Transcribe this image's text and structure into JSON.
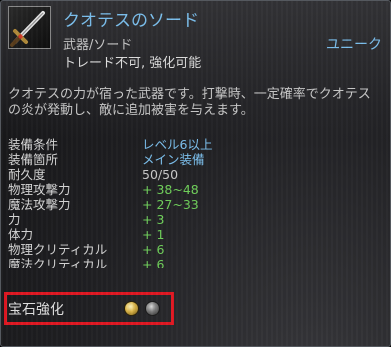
{
  "item": {
    "name": "クオテスのソード",
    "type": "武器/ソード",
    "rarity": "ユニーク",
    "trade_status": "トレード不可, 強化可能",
    "icon": "sword-icon",
    "description": "クオテスの力が宿った武器です。打撃時、一定確率でクオテス\nの炎が発動し、敵に追加被害を与えます。"
  },
  "stats": [
    {
      "label": "装備条件",
      "value": "レベル6以上",
      "color": "#7cc0ee"
    },
    {
      "label": "装備箇所",
      "value": "メイン装備",
      "color": "#7cc0ee"
    },
    {
      "label": "耐久度",
      "value": "50/50",
      "color": "#c8c8c8"
    },
    {
      "label": "物理攻撃力",
      "value": "+ 38~48",
      "color": "#6fcf5a"
    },
    {
      "label": "魔法攻撃力",
      "value": "+ 27~33",
      "color": "#6fcf5a"
    },
    {
      "label": "力",
      "value": "+ 3",
      "color": "#6fcf5a"
    },
    {
      "label": "体力",
      "value": "+ 1",
      "color": "#6fcf5a"
    },
    {
      "label": "物理クリティカル",
      "value": "+ 6",
      "color": "#6fcf5a"
    },
    {
      "label": "魔法クリティカル",
      "value": "+ 6",
      "color": "#6fcf5a"
    }
  ],
  "gem": {
    "label": "宝石強化",
    "slots": [
      {
        "icon": "gold-gem-slot-icon",
        "color": "#d9b347"
      },
      {
        "icon": "empty-gem-slot-icon",
        "color": "#7a7a7a"
      }
    ],
    "highlight_color": "#e01822"
  }
}
